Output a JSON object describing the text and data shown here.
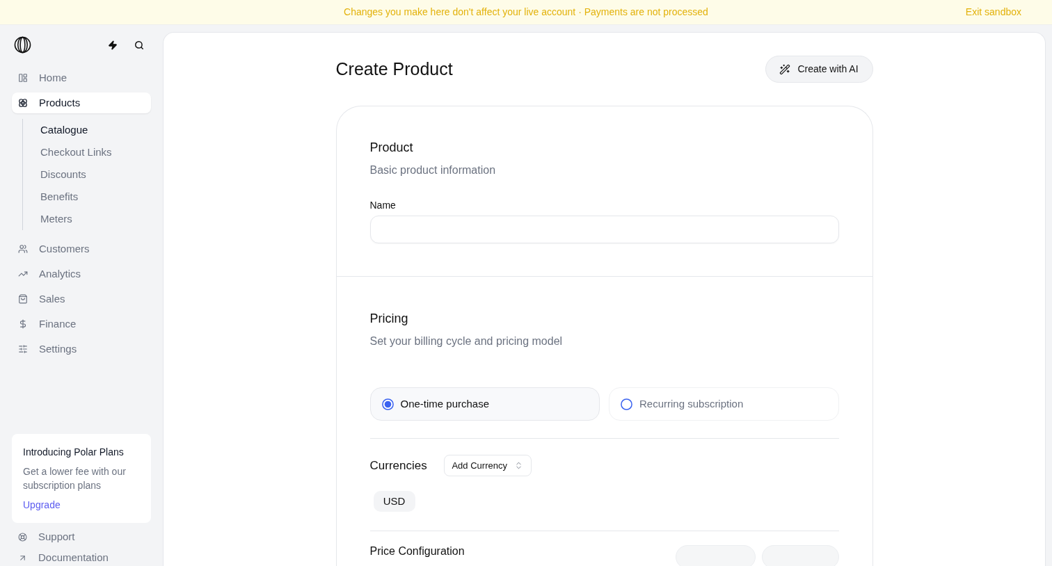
{
  "banner": {
    "message": "Changes you make here don't affect your live account · Payments are not processed",
    "exit_link": "Exit sandbox"
  },
  "sidebar": {
    "nav": [
      {
        "label": "Home",
        "selected": false
      },
      {
        "label": "Products",
        "selected": true,
        "children": [
          {
            "label": "Catalogue",
            "selected": true
          },
          {
            "label": "Checkout Links",
            "selected": false
          },
          {
            "label": "Discounts",
            "selected": false
          },
          {
            "label": "Benefits",
            "selected": false
          },
          {
            "label": "Meters",
            "selected": false
          }
        ]
      },
      {
        "label": "Customers",
        "selected": false
      },
      {
        "label": "Analytics",
        "selected": false
      },
      {
        "label": "Sales",
        "selected": false
      },
      {
        "label": "Finance",
        "selected": false
      },
      {
        "label": "Settings",
        "selected": false
      }
    ],
    "promo": {
      "title": "Introducing Polar Plans",
      "text": "Get a lower fee with our subscription plans",
      "link": "Upgrade"
    },
    "footer_links": [
      {
        "label": "Support"
      },
      {
        "label": "Documentation"
      }
    ]
  },
  "page": {
    "title": "Create Product",
    "ai_button": "Create with AI"
  },
  "product_section": {
    "title": "Product",
    "subtitle": "Basic product information",
    "name_field": {
      "label": "Name"
    }
  },
  "pricing_section": {
    "title": "Pricing",
    "subtitle": "Set your billing cycle and pricing model",
    "billing_options": [
      {
        "label": "One-time purchase",
        "selected": true
      },
      {
        "label": "Recurring subscription",
        "selected": false
      }
    ],
    "currencies": {
      "label": "Currencies",
      "add_button": "Add Currency",
      "items": [
        "USD"
      ]
    },
    "price_configuration": {
      "title": "Price Configuration",
      "actions": [
        {
          "disabled": true
        },
        {
          "disabled": true
        }
      ]
    }
  }
}
